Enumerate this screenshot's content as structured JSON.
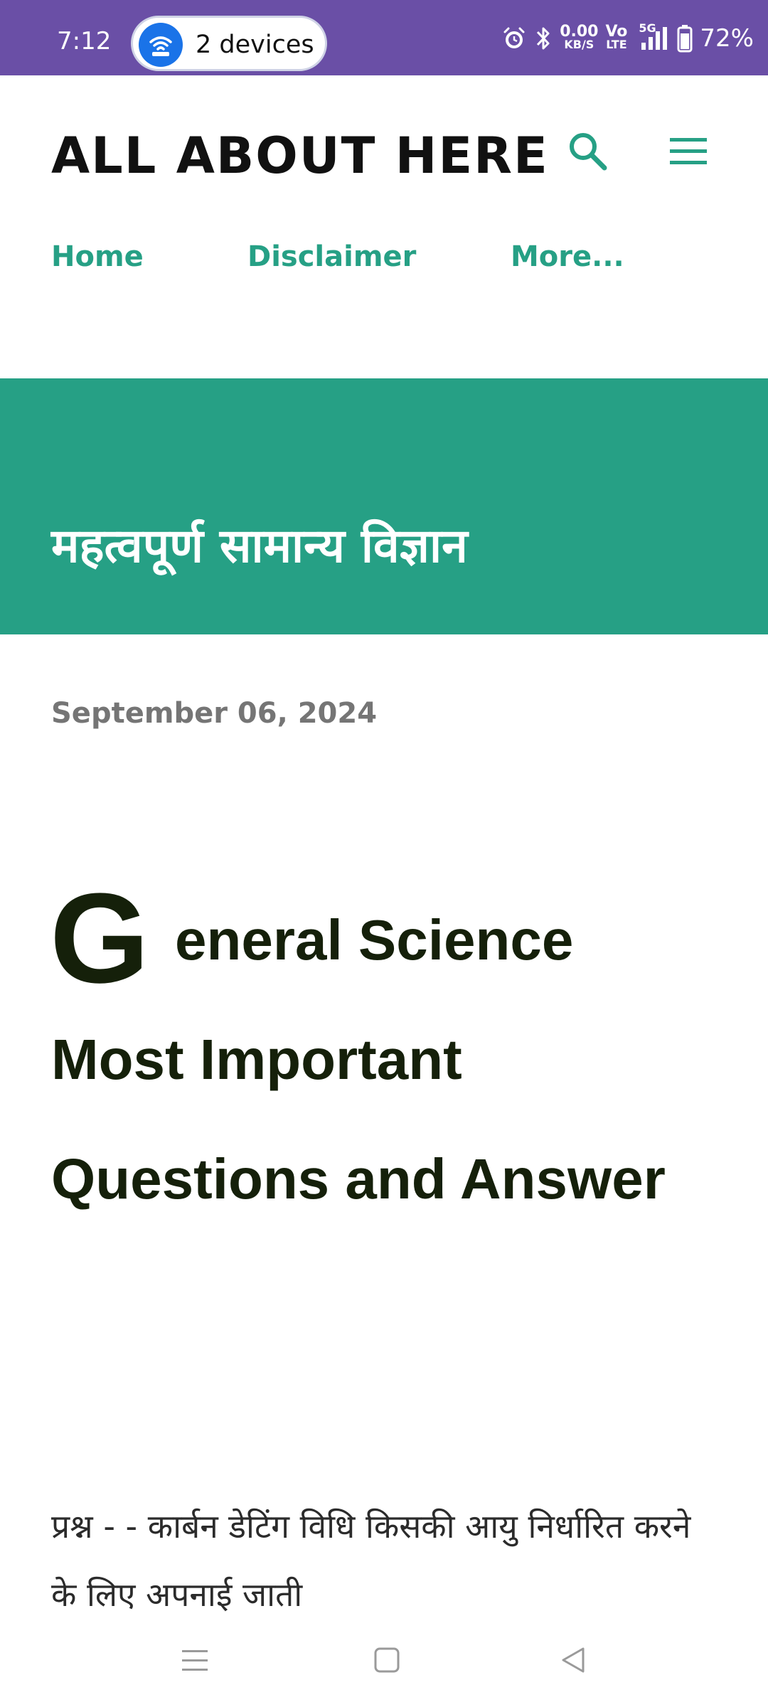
{
  "status_bar": {
    "time": "7:12",
    "hotspot_label": "2 devices",
    "net_speed_value": "0.00",
    "net_speed_unit": "KB/S",
    "volte_top": "Vo",
    "volte_bottom": "LTE",
    "network_type": "5G",
    "battery_percent": "72%",
    "icons": [
      "hotspot-icon",
      "alarm-icon",
      "bluetooth-icon",
      "signal-icon",
      "battery-icon"
    ]
  },
  "header": {
    "site_title": "ALL ABOUT HERE",
    "nav_items": [
      "Home",
      "Disclaimer",
      "More..."
    ],
    "accent_color": "#26a085"
  },
  "banner": {
    "title": "महत्वपूर्ण सामान्य विज्ञान",
    "background_color": "#26a085"
  },
  "post": {
    "date": "September 06, 2024",
    "dropcap": "G",
    "heading_line1": "eneral Science",
    "heading_line2": "Most Important",
    "heading_line3": "Questions and Answer",
    "question_text": "प्रश्न - - कार्बन डेटिंग विधि किसकी आयु निर्धारित करने के लिए अपनाई जाती"
  },
  "system_nav": {
    "icons": [
      "recent-apps-icon",
      "home-icon",
      "back-icon"
    ]
  }
}
